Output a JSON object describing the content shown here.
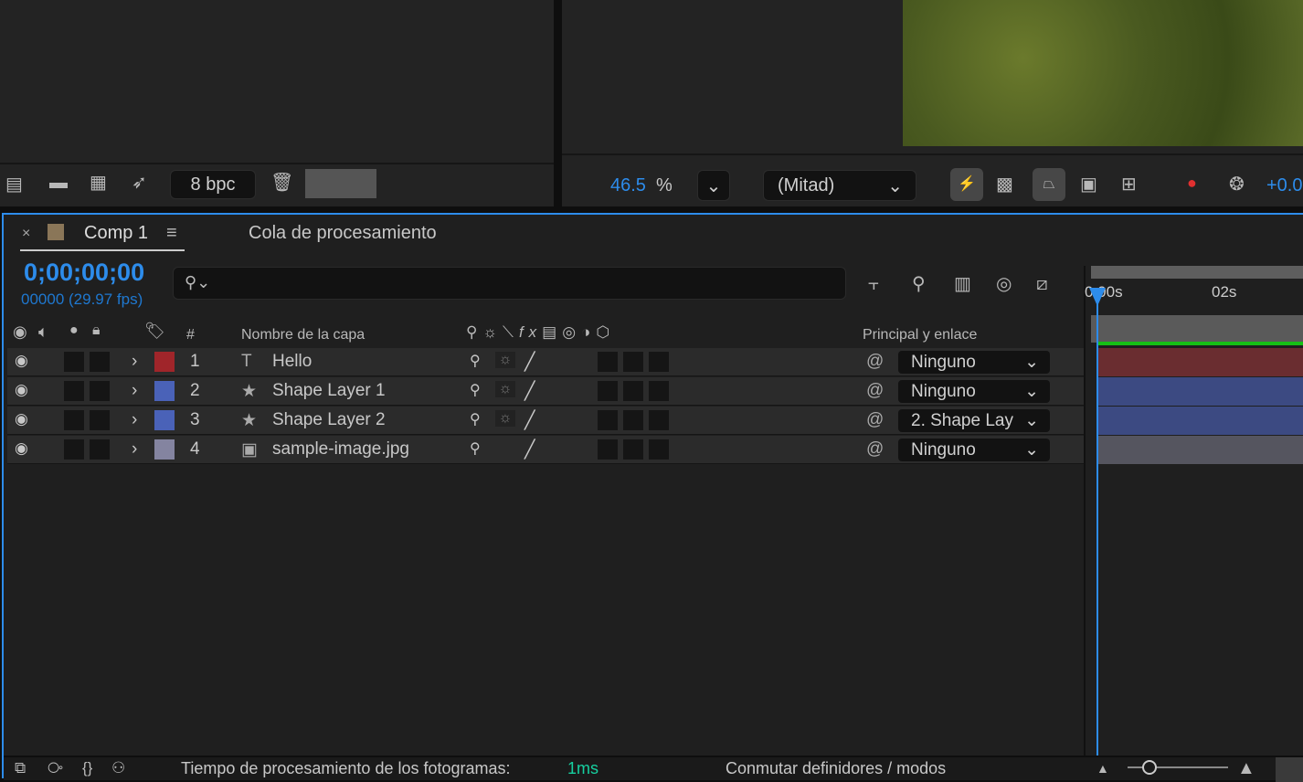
{
  "project_toolbar": {
    "bit_depth": "8 bpc",
    "icons": [
      "interpret-footage-icon",
      "folder-icon",
      "new-composition-icon",
      "render-rocket-icon",
      "trash-icon"
    ]
  },
  "viewer_toolbar": {
    "zoom_value": "46.5",
    "zoom_unit": "%",
    "resolution": "(Mitad)",
    "exposure": "+0.0"
  },
  "timeline": {
    "tabs": [
      {
        "label": "Comp 1",
        "active": true,
        "color": "#8a7658"
      },
      {
        "label": "Cola de procesamiento",
        "active": false
      }
    ],
    "timecode": "0;00;00;00",
    "frame_info": "00000 (29.97 fps)",
    "search_placeholder": "",
    "columns": {
      "number": "#",
      "layer_name": "Nombre de la capa",
      "parent": "Principal y enlace"
    },
    "ruler": {
      "start": "0:00s",
      "mark": "02s"
    },
    "layers": [
      {
        "num": "1",
        "type": "text",
        "icon": "T",
        "name": "Hello",
        "label_color": "#a0252a",
        "parent": "Ninguno",
        "bar_color": "#6a2d30"
      },
      {
        "num": "2",
        "type": "shape",
        "icon": "★",
        "name": "Shape Layer 1",
        "label_color": "#4a62b8",
        "parent": "Ninguno",
        "bar_color": "#3c4a82"
      },
      {
        "num": "3",
        "type": "shape",
        "icon": "★",
        "name": "Shape Layer 2",
        "label_color": "#4a62b8",
        "parent": "2. Shape Lay",
        "bar_color": "#3c4a82"
      },
      {
        "num": "4",
        "type": "footage",
        "icon": "▣",
        "name": "sample-image.jpg",
        "label_color": "#8484a0",
        "parent": "Ninguno",
        "bar_color": "#55555f"
      }
    ],
    "status": {
      "render_time_label": "Tiempo de procesamiento de los fotogramas:",
      "render_time_value": "1ms",
      "toggle_label": "Conmutar definidores / modos"
    }
  }
}
